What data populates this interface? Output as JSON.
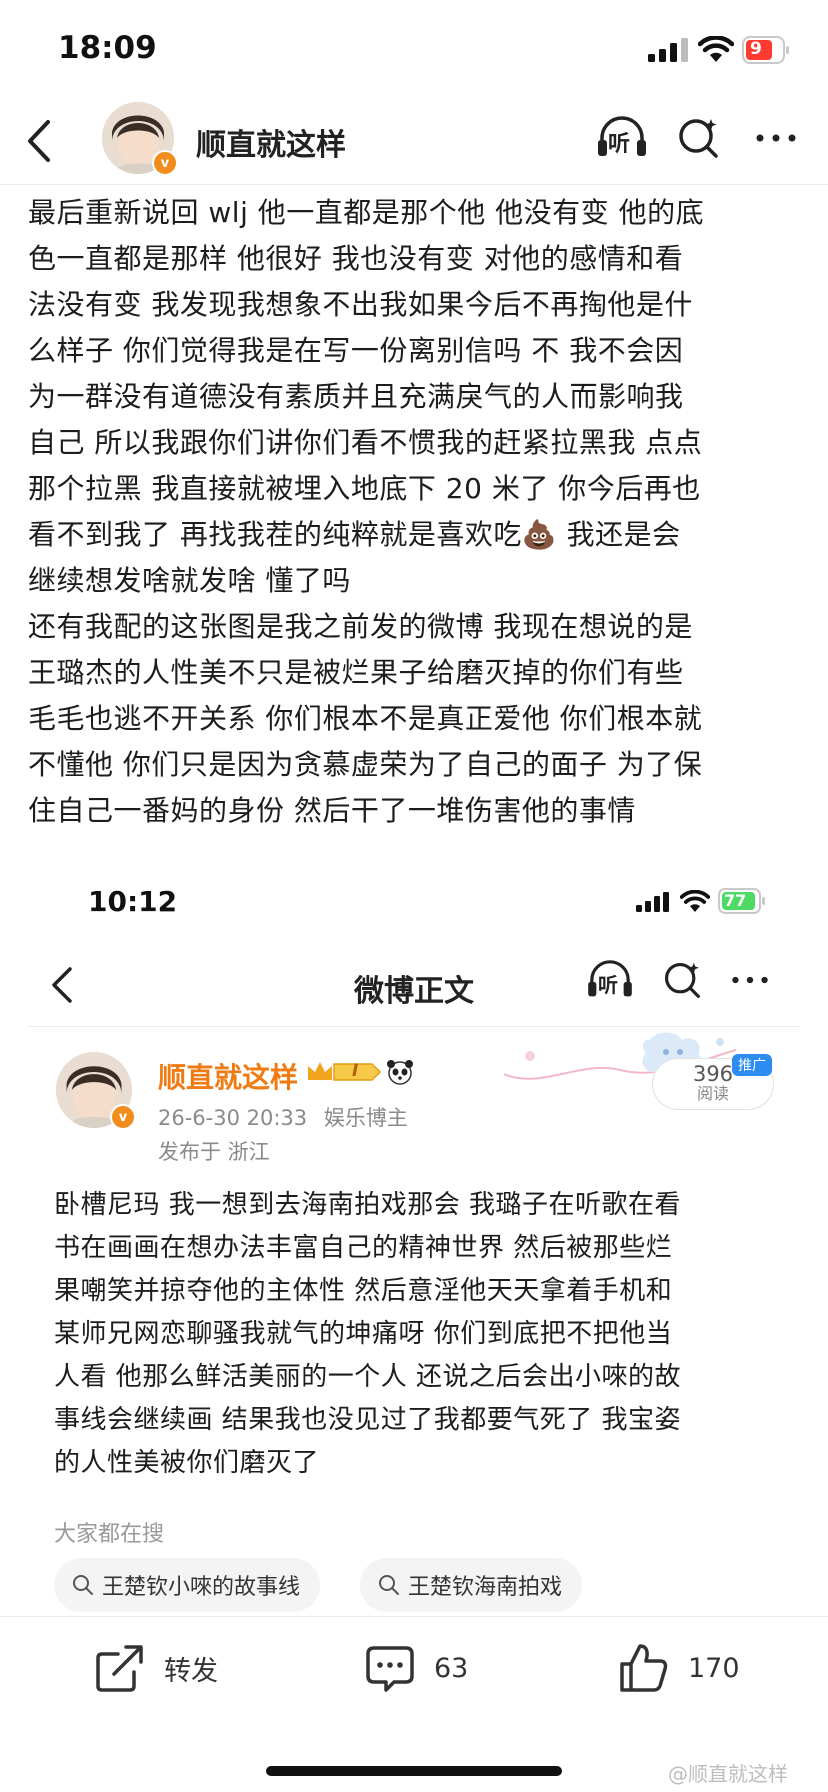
{
  "status_bar": {
    "time": "18:09",
    "battery": "9"
  },
  "header": {
    "name": "顺直就这样",
    "back_icon": "chevron-left-icon",
    "listen_label": "听"
  },
  "main_text": {
    "lines": [
      "最后重新说回 wlj 他一直都是那个他 他没有变 他的底",
      "色一直都是那样 他很好  我也没有变 对他的感情和看",
      "法没有变 我发现我想象不出我如果今后不再掏他是什",
      "么样子 你们觉得我是在写一份离别信吗 不 我不会因",
      "为一群没有道德没有素质并且充满戾气的人而影响我",
      "自己 所以我跟你们讲你们看不惯我的赶紧拉黑我 点点",
      "那个拉黑 我直接就被埋入地底下 20 米了 你今后再也",
      "看不到我了 再找我茬的纯粹就是喜欢吃💩 我还是会",
      "继续想发啥就发啥 懂了吗",
      "还有我配的这张图是我之前发的微博 我现在想说的是",
      "王璐杰的人性美不只是被烂果子给磨灭掉的你们有些",
      "毛毛也逃不开关系 你们根本不是真正爱他 你们根本就",
      "不懂他 你们只是因为贪慕虚荣为了自己的面子 为了保",
      "住自己一番妈的身份 然后干了一堆伤害他的事情"
    ]
  },
  "embedded": {
    "status_time": "10:12",
    "battery": "77",
    "title": "微博正文",
    "listen_label": "听",
    "post": {
      "name": "顺直就这样",
      "level_badge": "I",
      "time": "26-6-30 20:33",
      "role": "娱乐博主",
      "location": "发布于 浙江",
      "read_count": "396",
      "read_label": "阅读",
      "promo_tag": "推广",
      "lines": [
        "卧槽尼玛 我一想到去海南拍戏那会 我璐子在听歌在看",
        "书在画画在想办法丰富自己的精神世界 然后被那些烂",
        "果嘲笑并掠夺他的主体性 然后意淫他天天拿着手机和",
        "某师兄网恋聊骚我就气的坤痛呀 你们到底把不把他当",
        "人看 他那么鲜活美丽的一个人 还说之后会出小唻的故",
        "事线会继续画 结果我也没见过了我都要气死了 我宝姿",
        "的人性美被你们磨灭了"
      ]
    },
    "search": {
      "title": "大家都在搜",
      "chips": [
        "王楚钦小唻的故事线",
        "王楚钦海南拍戏"
      ]
    },
    "actions": {
      "repost_label": "转发",
      "comment_count": "63",
      "like_count": "170"
    }
  },
  "watermark": "@顺直就这样",
  "colors": {
    "accent_orange": "#f07b12",
    "battery_green": "#4cd964",
    "battery_red": "#ff3b30",
    "promo_blue": "#2d8cf0"
  }
}
